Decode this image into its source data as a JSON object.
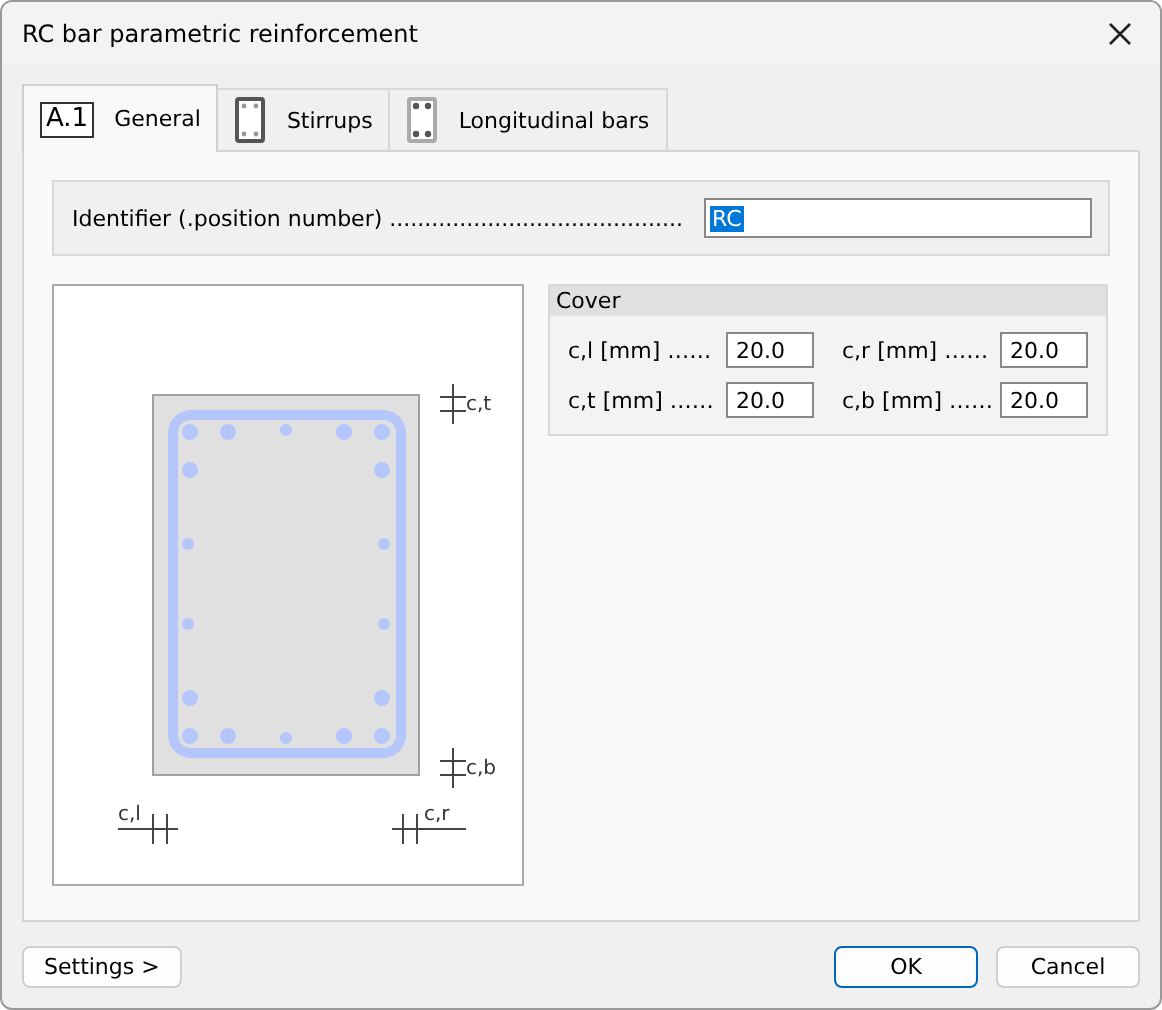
{
  "window": {
    "title": "RC bar parametric reinforcement"
  },
  "tabs": [
    {
      "kind": "label",
      "badge": "A.1",
      "label": "General",
      "selected": true
    },
    {
      "kind": "stirrups",
      "label": "Stirrups",
      "selected": false
    },
    {
      "kind": "bars",
      "label": "Longitudinal bars",
      "selected": false
    }
  ],
  "identifier": {
    "label": "Identifier (.position number) ..........................................",
    "value": "RC",
    "value_selected": true
  },
  "drawing": {
    "dimension_labels": [
      {
        "kind": "top",
        "text": "c,t"
      },
      {
        "kind": "bottom",
        "text": "c,b"
      },
      {
        "kind": "left",
        "text": "c,l"
      },
      {
        "kind": "right",
        "text": "c,r"
      }
    ]
  },
  "cover": {
    "title": "Cover",
    "fields": [
      {
        "label": "c,l [mm] ……",
        "value": "20.0"
      },
      {
        "label": "c,r [mm] ……",
        "value": "20.0"
      },
      {
        "label": "c,t [mm] ……",
        "value": "20.0"
      },
      {
        "label": "c,b [mm] ……",
        "value": "20.0"
      }
    ]
  },
  "left_buttons": [
    {
      "label": "Settings >",
      "default": false
    }
  ],
  "right_buttons": [
    {
      "label": "OK",
      "default": true
    },
    {
      "label": "Cancel",
      "default": false
    }
  ]
}
